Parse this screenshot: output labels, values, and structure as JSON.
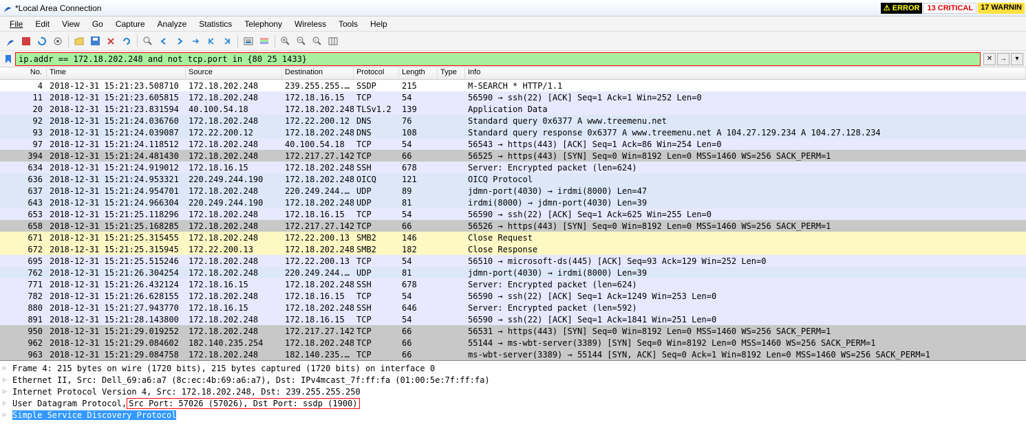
{
  "window": {
    "title": "*Local Area Connection"
  },
  "status": {
    "error": "ERROR",
    "critical": "13 CRITICAL",
    "warning": "17 WARNIN"
  },
  "menu": [
    "File",
    "Edit",
    "View",
    "Go",
    "Capture",
    "Analyze",
    "Statistics",
    "Telephony",
    "Wireless",
    "Tools",
    "Help"
  ],
  "filter": {
    "value": "ip.addr == 172.18.202.248 and not tcp.port in {80 25 1433}"
  },
  "columns": [
    "No.",
    "Time",
    "Source",
    "Destination",
    "Protocol",
    "Length",
    "Type",
    "Info"
  ],
  "packets": [
    {
      "no": "4",
      "time": "2018-12-31 15:21:23.508710",
      "src": "172.18.202.248",
      "dst": "239.255.255.…",
      "proto": "SSDP",
      "len": "215",
      "info": "M-SEARCH * HTTP/1.1",
      "bg": "white"
    },
    {
      "no": "11",
      "time": "2018-12-31 15:21:23.605815",
      "src": "172.18.202.248",
      "dst": "172.18.16.15",
      "proto": "TCP",
      "len": "54",
      "info": "56590 → ssh(22) [ACK] Seq=1 Ack=1 Win=252 Len=0",
      "bg": "lav"
    },
    {
      "no": "20",
      "time": "2018-12-31 15:21:23.831594",
      "src": "40.100.54.18",
      "dst": "172.18.202.248",
      "proto": "TLSv1.2",
      "len": "139",
      "info": "Application Data",
      "bg": "lav"
    },
    {
      "no": "92",
      "time": "2018-12-31 15:21:24.036760",
      "src": "172.18.202.248",
      "dst": "172.22.200.12",
      "proto": "DNS",
      "len": "76",
      "info": "Standard query 0x6377 A www.treemenu.net",
      "bg": "blue"
    },
    {
      "no": "93",
      "time": "2018-12-31 15:21:24.039087",
      "src": "172.22.200.12",
      "dst": "172.18.202.248",
      "proto": "DNS",
      "len": "108",
      "info": "Standard query response 0x6377 A www.treemenu.net A 104.27.129.234 A 104.27.128.234",
      "bg": "blue"
    },
    {
      "no": "97",
      "time": "2018-12-31 15:21:24.118512",
      "src": "172.18.202.248",
      "dst": "40.100.54.18",
      "proto": "TCP",
      "len": "54",
      "info": "56543 → https(443) [ACK] Seq=1 Ack=86 Win=254 Len=0",
      "bg": "lav"
    },
    {
      "no": "394",
      "time": "2018-12-31 15:21:24.481430",
      "src": "172.18.202.248",
      "dst": "172.217.27.142",
      "proto": "TCP",
      "len": "66",
      "info": "56525 → https(443) [SYN] Seq=0 Win=8192 Len=0 MSS=1460 WS=256 SACK_PERM=1",
      "bg": "gray"
    },
    {
      "no": "634",
      "time": "2018-12-31 15:21:24.919012",
      "src": "172.18.16.15",
      "dst": "172.18.202.248",
      "proto": "SSH",
      "len": "678",
      "info": "Server: Encrypted packet (len=624)",
      "bg": "lav"
    },
    {
      "no": "636",
      "time": "2018-12-31 15:21:24.953321",
      "src": "220.249.244.190",
      "dst": "172.18.202.248",
      "proto": "OICQ",
      "len": "121",
      "info": "OICQ Protocol",
      "bg": "blue"
    },
    {
      "no": "637",
      "time": "2018-12-31 15:21:24.954701",
      "src": "172.18.202.248",
      "dst": "220.249.244.…",
      "proto": "UDP",
      "len": "89",
      "info": "jdmn-port(4030) → irdmi(8000) Len=47",
      "bg": "blue"
    },
    {
      "no": "643",
      "time": "2018-12-31 15:21:24.966304",
      "src": "220.249.244.190",
      "dst": "172.18.202.248",
      "proto": "UDP",
      "len": "81",
      "info": "irdmi(8000) → jdmn-port(4030) Len=39",
      "bg": "blue"
    },
    {
      "no": "653",
      "time": "2018-12-31 15:21:25.118296",
      "src": "172.18.202.248",
      "dst": "172.18.16.15",
      "proto": "TCP",
      "len": "54",
      "info": "56590 → ssh(22) [ACK] Seq=1 Ack=625 Win=255 Len=0",
      "bg": "lav"
    },
    {
      "no": "658",
      "time": "2018-12-31 15:21:25.168285",
      "src": "172.18.202.248",
      "dst": "172.217.27.142",
      "proto": "TCP",
      "len": "66",
      "info": "56526 → https(443) [SYN] Seq=0 Win=8192 Len=0 MSS=1460 WS=256 SACK_PERM=1",
      "bg": "gray"
    },
    {
      "no": "671",
      "time": "2018-12-31 15:21:25.315455",
      "src": "172.18.202.248",
      "dst": "172.22.200.13",
      "proto": "SMB2",
      "len": "146",
      "info": "Close Request",
      "bg": "yellow"
    },
    {
      "no": "672",
      "time": "2018-12-31 15:21:25.315945",
      "src": "172.22.200.13",
      "dst": "172.18.202.248",
      "proto": "SMB2",
      "len": "182",
      "info": "Close Response",
      "bg": "yellow"
    },
    {
      "no": "695",
      "time": "2018-12-31 15:21:25.515246",
      "src": "172.18.202.248",
      "dst": "172.22.200.13",
      "proto": "TCP",
      "len": "54",
      "info": "56510 → microsoft-ds(445) [ACK] Seq=93 Ack=129 Win=252 Len=0",
      "bg": "lav"
    },
    {
      "no": "762",
      "time": "2018-12-31 15:21:26.304254",
      "src": "172.18.202.248",
      "dst": "220.249.244.…",
      "proto": "UDP",
      "len": "81",
      "info": "jdmn-port(4030) → irdmi(8000) Len=39",
      "bg": "blue"
    },
    {
      "no": "771",
      "time": "2018-12-31 15:21:26.432124",
      "src": "172.18.16.15",
      "dst": "172.18.202.248",
      "proto": "SSH",
      "len": "678",
      "info": "Server: Encrypted packet (len=624)",
      "bg": "lav"
    },
    {
      "no": "782",
      "time": "2018-12-31 15:21:26.628155",
      "src": "172.18.202.248",
      "dst": "172.18.16.15",
      "proto": "TCP",
      "len": "54",
      "info": "56590 → ssh(22) [ACK] Seq=1 Ack=1249 Win=253 Len=0",
      "bg": "lav"
    },
    {
      "no": "880",
      "time": "2018-12-31 15:21:27.943770",
      "src": "172.18.16.15",
      "dst": "172.18.202.248",
      "proto": "SSH",
      "len": "646",
      "info": "Server: Encrypted packet (len=592)",
      "bg": "lav"
    },
    {
      "no": "891",
      "time": "2018-12-31 15:21:28.143800",
      "src": "172.18.202.248",
      "dst": "172.18.16.15",
      "proto": "TCP",
      "len": "54",
      "info": "56590 → ssh(22) [ACK] Seq=1 Ack=1841 Win=251 Len=0",
      "bg": "lav"
    },
    {
      "no": "950",
      "time": "2018-12-31 15:21:29.019252",
      "src": "172.18.202.248",
      "dst": "172.217.27.142",
      "proto": "TCP",
      "len": "66",
      "info": "56531 → https(443) [SYN] Seq=0 Win=8192 Len=0 MSS=1460 WS=256 SACK_PERM=1",
      "bg": "gray"
    },
    {
      "no": "962",
      "time": "2018-12-31 15:21:29.084602",
      "src": "182.140.235.254",
      "dst": "172.18.202.248",
      "proto": "TCP",
      "len": "66",
      "info": "55144 → ms-wbt-server(3389) [SYN] Seq=0 Win=8192 Len=0 MSS=1460 WS=256 SACK_PERM=1",
      "bg": "gray"
    },
    {
      "no": "963",
      "time": "2018-12-31 15:21:29.084758",
      "src": "172.18.202.248",
      "dst": "182.140.235.…",
      "proto": "TCP",
      "len": "66",
      "info": "ms-wbt-server(3389) → 55144 [SYN, ACK] Seq=0 Ack=1 Win=8192 Len=0 MSS=1460 WS=256 SACK_PERM=1",
      "bg": "gray"
    }
  ],
  "details": {
    "l0": "Frame 4: 215 bytes on wire (1720 bits), 215 bytes captured (1720 bits) on interface 0",
    "l1": "Ethernet II, Src: Dell_69:a6:a7 (8c:ec:4b:69:a6:a7), Dst: IPv4mcast_7f:ff:fa (01:00:5e:7f:ff:fa)",
    "l2": "Internet Protocol Version 4, Src: 172.18.202.248, Dst: 239.255.255.250",
    "l3a": "User Datagram Protocol, ",
    "l3b": "Src Port: 57026 (57026), Dst Port: ssdp (1900)",
    "l4": "Simple Service Discovery Protocol"
  }
}
